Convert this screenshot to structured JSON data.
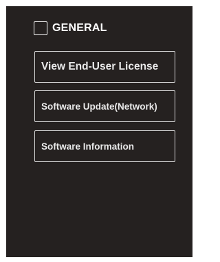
{
  "section": {
    "title": "GENERAL",
    "icon": "checkbox-outline-icon"
  },
  "menu": {
    "items": [
      {
        "label": "View End-User License"
      },
      {
        "label": "Software Update(Network)"
      },
      {
        "label": "Software Information"
      }
    ]
  },
  "colors": {
    "panel_background": "#252120",
    "text": "#ffffff",
    "button_border": "#d8d8d8"
  }
}
